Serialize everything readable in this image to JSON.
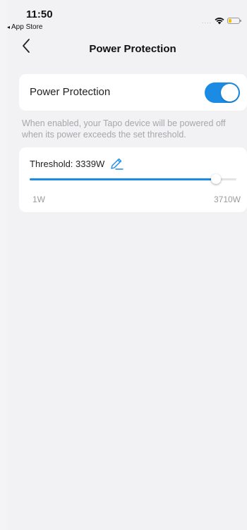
{
  "status_bar": {
    "time": "11:50",
    "back_app_label": "App Store",
    "back_app_glyph": "◂",
    "signal": "....",
    "wifi_icon": "wifi-icon",
    "battery_icon": "battery-icon",
    "battery_color": "#f2c500"
  },
  "nav": {
    "title": "Power Protection",
    "back_icon": "chevron-left-icon"
  },
  "power_protection": {
    "label": "Power Protection",
    "enabled": true,
    "accent_color": "#1b8be3"
  },
  "description": "When enabled, your Tapo device will be powered off when its power exceeds the set threshold.",
  "threshold": {
    "label": "Threshold: 3339W",
    "edit_icon": "pencil-icon",
    "slider_fraction": 0.9,
    "min_label": "1W",
    "max_label": "3710W"
  }
}
